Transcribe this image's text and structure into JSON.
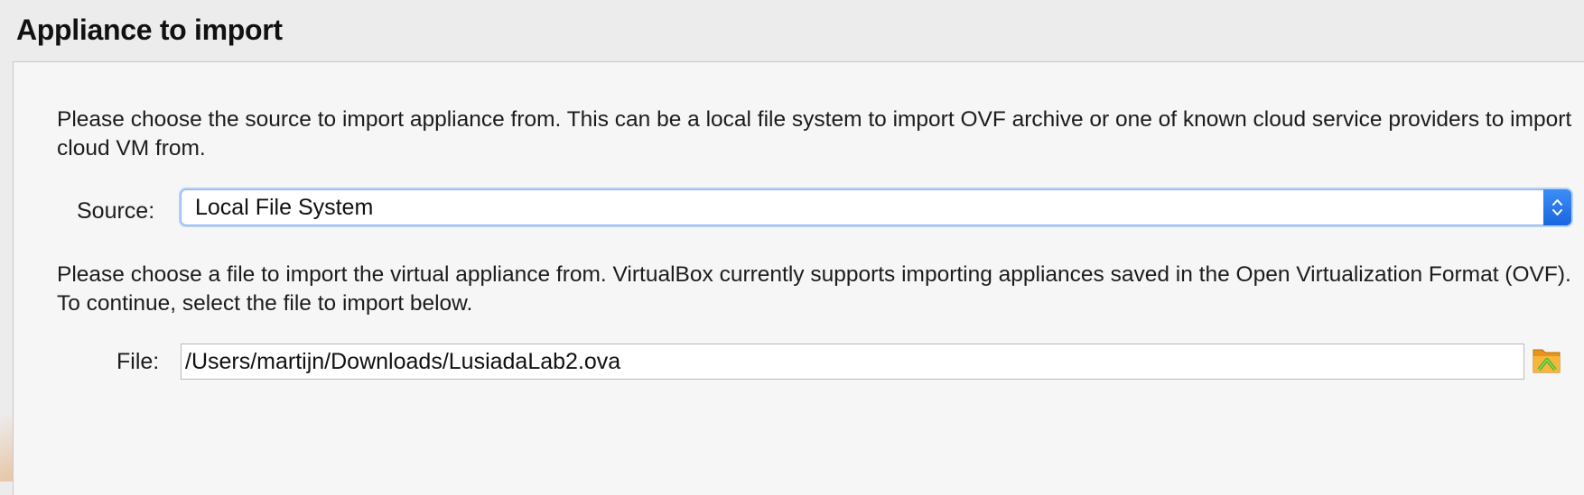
{
  "header": {
    "title": "Appliance to import"
  },
  "main": {
    "intro_text": "Please choose the source to import appliance from. This can be a local file system to import OVF archive or one of known cloud service providers to import cloud VM from.",
    "source": {
      "label": "Source:",
      "selected": "Local File System"
    },
    "file_instructions": "Please choose a file to import the virtual appliance from. VirtualBox currently supports importing appliances saved in the Open Virtualization Format (OVF). To continue, select the file to import below.",
    "file": {
      "label": "File:",
      "value": "/Users/martijn/Downloads/LusiadaLab2.ova",
      "browse_icon": "folder-open-icon"
    }
  },
  "colors": {
    "accent": "#1a66e0",
    "focus_ring": "#b7d1f5",
    "folder": "#f2a92c",
    "folder_arrow": "#5cbf2a"
  }
}
